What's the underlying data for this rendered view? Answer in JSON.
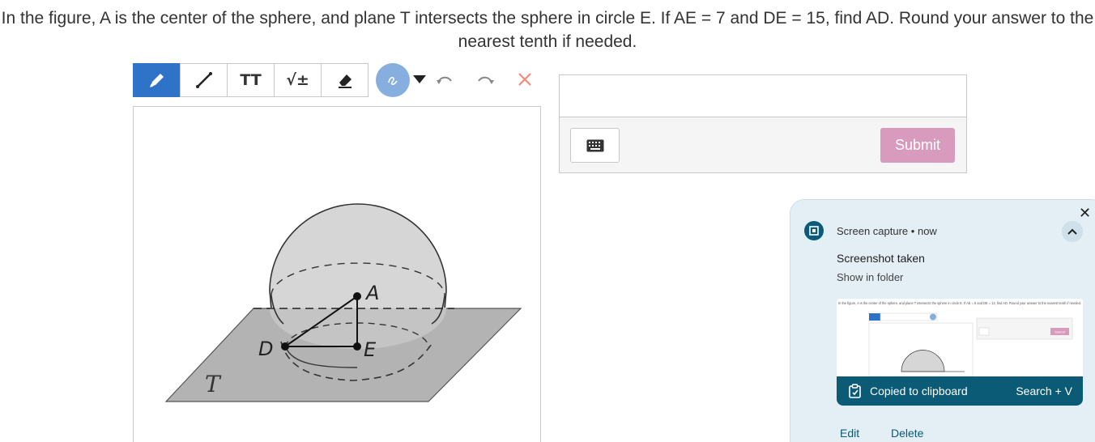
{
  "question": {
    "text": "In the figure, A is the center of the sphere, and plane T intersects the sphere in circle E. If AE = 7 and DE = 15, find AD. Round your answer to the nearest tenth if needed."
  },
  "toolbar": {
    "tools": [
      {
        "name": "pencil-icon",
        "active": true
      },
      {
        "name": "line-icon",
        "active": false
      },
      {
        "name": "text-size-icon",
        "label": "TT",
        "active": false
      },
      {
        "name": "math-icon",
        "label": "√±",
        "active": false
      },
      {
        "name": "eraser-icon",
        "active": false
      }
    ],
    "color_selected": "#86aede",
    "icons": [
      "dropdown-caret-icon",
      "undo-icon",
      "redo-icon",
      "clear-icon"
    ]
  },
  "figure": {
    "labels": {
      "a": "A",
      "d": "D",
      "e": "E",
      "plane": "T"
    }
  },
  "answer": {
    "value": "",
    "submit_label": "Submit",
    "submit_color": "#d99bbd"
  },
  "notification": {
    "app": "Screen capture",
    "time": "now",
    "title": "Screenshot taken",
    "subtitle": "Show in folder",
    "copied": "Copied to clipboard",
    "shortcut": "Search + V",
    "edit": "Edit",
    "delete": "Delete",
    "thumbnail_text": "In the figure, A is the center of the sphere, and plane T intersects the sphere in circle E. If AE = 5 and DE = 12, find AD. Round your answer to the nearest tenth if needed.",
    "thumbnail_submit": "Submit",
    "accent": "#0b5a76"
  }
}
